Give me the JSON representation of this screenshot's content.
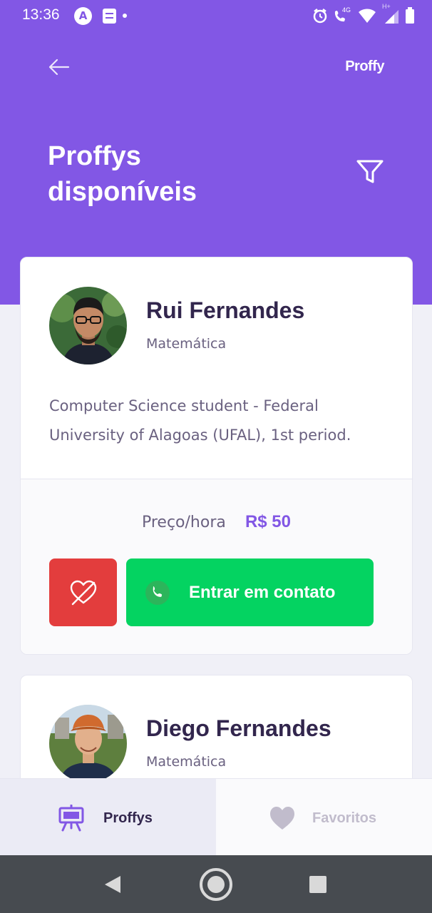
{
  "status_bar": {
    "time": "13:36",
    "app_badge": "A",
    "network": "4G",
    "signal_type": "H+"
  },
  "header": {
    "brand": "Proffy",
    "title": "Proffys disponíveis"
  },
  "teachers": [
    {
      "name": "Rui Fernandes",
      "subject": "Matemática",
      "bio": "Computer Science student - Federal University of Alagoas (UFAL), 1st period.",
      "price_label": "Preço/hora",
      "price_value": "R$ 50",
      "contact_label": "Entrar em contato",
      "favorited": true
    },
    {
      "name": "Diego Fernandes",
      "subject": "Matemática"
    }
  ],
  "tabs": [
    {
      "label": "Proffys",
      "active": true
    },
    {
      "label": "Favoritos",
      "active": false
    }
  ],
  "colors": {
    "primary": "#8257E5",
    "title": "#32264D",
    "text": "#6A6180",
    "favorite_button": "#E33D3D",
    "contact_button": "#04D361",
    "background": "#F0F0F7"
  },
  "icons": {
    "back": "arrow-left-icon",
    "filter": "filter-icon",
    "favorite_button": "heart-broken-icon",
    "contact_button": "whatsapp-icon",
    "tab_proffys": "easel-icon",
    "tab_favorites": "heart-icon"
  }
}
